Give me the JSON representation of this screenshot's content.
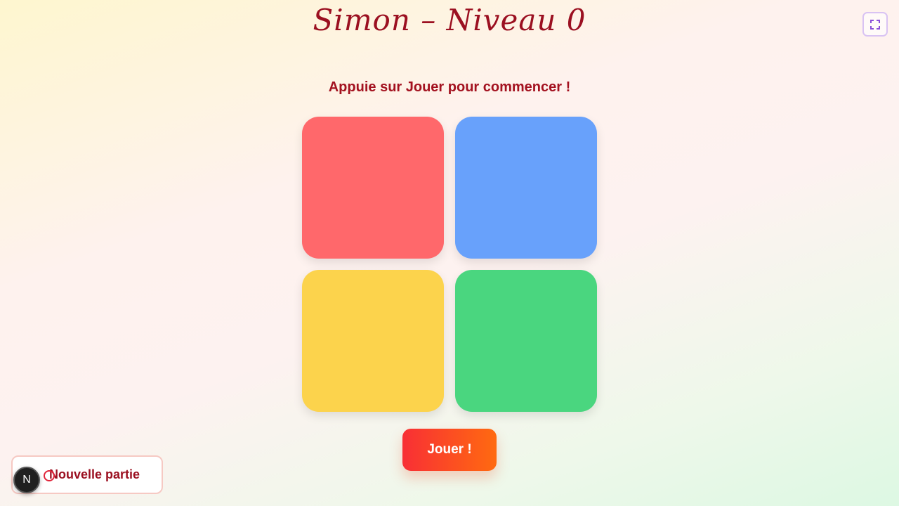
{
  "header": {
    "title": "Simon – Niveau 0",
    "fullscreen_icon": "fullscreen-icon"
  },
  "status": {
    "instruction": "Appuie sur Jouer pour commencer !"
  },
  "pads": [
    {
      "color_name": "red",
      "color": "#ff686b"
    },
    {
      "color_name": "blue",
      "color": "#68a1fb"
    },
    {
      "color_name": "yellow",
      "color": "#fcd34c"
    },
    {
      "color_name": "green",
      "color": "#4ad67f"
    }
  ],
  "controls": {
    "play_label": "Jouer !",
    "new_game_label": "Nouvelle partie"
  },
  "dev_badge": {
    "label": "N"
  },
  "colors": {
    "accent_dark_red": "#9b1021",
    "play_gradient_start": "#f82f35",
    "play_gradient_end": "#ff6a10"
  }
}
